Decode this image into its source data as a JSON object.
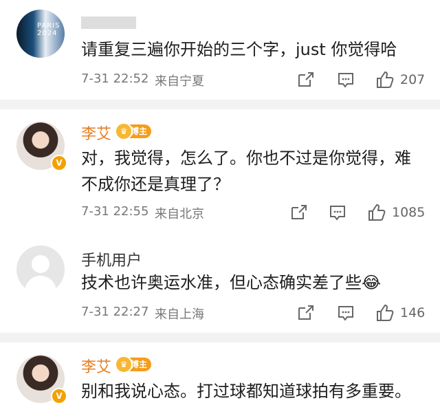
{
  "comments": [
    {
      "name": "",
      "text": "请重复三遍你开始的三个字，just 你觉得哈",
      "time": "7-31 22:52",
      "location": "来自宁夏",
      "likes": "207"
    },
    {
      "name": "李艾",
      "badge": "博主",
      "text_line1": "对，我觉得，怎么了。你也不过是你觉得，难",
      "text_line2": "不成你还是真理了？",
      "time": "7-31 22:55",
      "location": "来自北京",
      "likes": "1085"
    },
    {
      "name": "手机用户",
      "text": "技术也许奥运水准，但心态确实差了些",
      "emoji": "😂",
      "time": "7-31 22:27",
      "location": "来自上海",
      "likes": "146"
    },
    {
      "name": "李艾",
      "badge": "博主",
      "text": "别和我说心态。打过球都知道球拍有多重要。"
    }
  ],
  "avatar1_text": "PARIS 2024"
}
